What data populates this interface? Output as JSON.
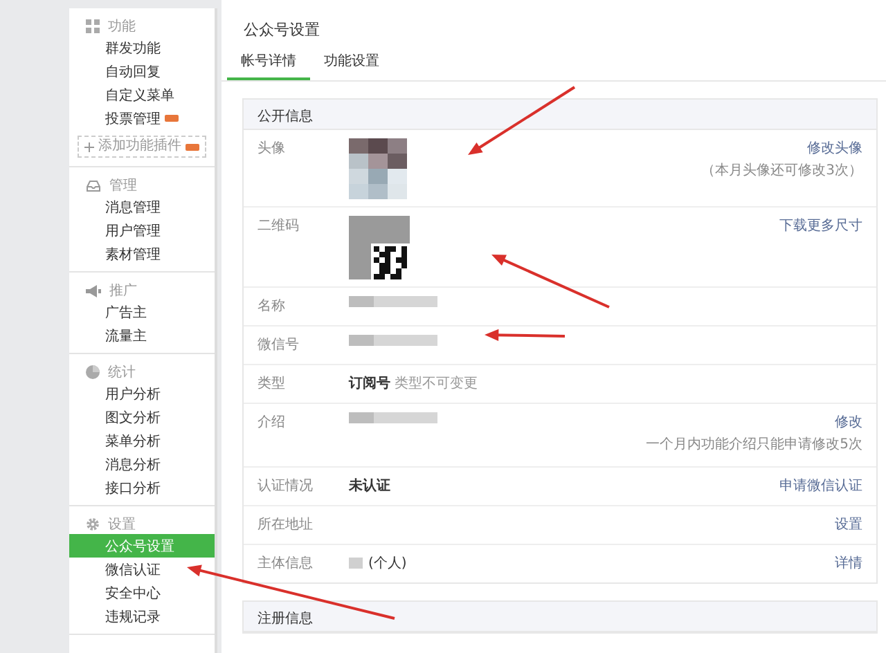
{
  "sidebar": {
    "sections": [
      {
        "title": "功能",
        "items": [
          {
            "label": "群发功能",
            "selected": false,
            "new": false
          },
          {
            "label": "自动回复",
            "selected": false,
            "new": false
          },
          {
            "label": "自定义菜单",
            "selected": false,
            "new": false
          },
          {
            "label": "投票管理",
            "selected": false,
            "new": true
          }
        ],
        "add_button": {
          "label": "添加功能插件",
          "new": true
        }
      },
      {
        "title": "管理",
        "items": [
          {
            "label": "消息管理",
            "selected": false,
            "new": false
          },
          {
            "label": "用户管理",
            "selected": false,
            "new": false
          },
          {
            "label": "素材管理",
            "selected": false,
            "new": false
          }
        ]
      },
      {
        "title": "推广",
        "items": [
          {
            "label": "广告主",
            "selected": false,
            "new": false
          },
          {
            "label": "流量主",
            "selected": false,
            "new": false
          }
        ]
      },
      {
        "title": "统计",
        "items": [
          {
            "label": "用户分析",
            "selected": false,
            "new": false
          },
          {
            "label": "图文分析",
            "selected": false,
            "new": false
          },
          {
            "label": "菜单分析",
            "selected": false,
            "new": false
          },
          {
            "label": "消息分析",
            "selected": false,
            "new": false
          },
          {
            "label": "接口分析",
            "selected": false,
            "new": false
          }
        ]
      },
      {
        "title": "设置",
        "items": [
          {
            "label": "公众号设置",
            "selected": true,
            "new": false
          },
          {
            "label": "微信认证",
            "selected": false,
            "new": false
          },
          {
            "label": "安全中心",
            "selected": false,
            "new": false
          },
          {
            "label": "违规记录",
            "selected": false,
            "new": false
          }
        ]
      }
    ]
  },
  "main": {
    "title": "公众号设置",
    "tabs": [
      {
        "label": "帐号详情",
        "selected": true
      },
      {
        "label": "功能设置",
        "selected": false
      }
    ],
    "panels": [
      {
        "title": "公开信息",
        "rows": [
          {
            "label": "头像",
            "kind": "avatar",
            "link": "修改头像",
            "hint": "（本月头像还可修改3次）"
          },
          {
            "label": "二维码",
            "kind": "qrcode",
            "link": "下载更多尺寸"
          },
          {
            "label": "名称",
            "kind": "redacted"
          },
          {
            "label": "微信号",
            "kind": "redacted"
          },
          {
            "label": "类型",
            "kind": "text",
            "value": "订阅号",
            "note": "类型不可变更"
          },
          {
            "label": "介绍",
            "kind": "redacted",
            "link": "修改",
            "hint": "一个月内功能介绍只能申请修改5次"
          },
          {
            "label": "认证情况",
            "kind": "text",
            "value": "未认证",
            "link": "申请微信认证"
          },
          {
            "label": "所在地址",
            "kind": "none",
            "link": "设置"
          },
          {
            "label": "主体信息",
            "kind": "subject",
            "value": "(个人)",
            "link": "详情"
          }
        ]
      },
      {
        "title": "注册信息"
      }
    ]
  }
}
